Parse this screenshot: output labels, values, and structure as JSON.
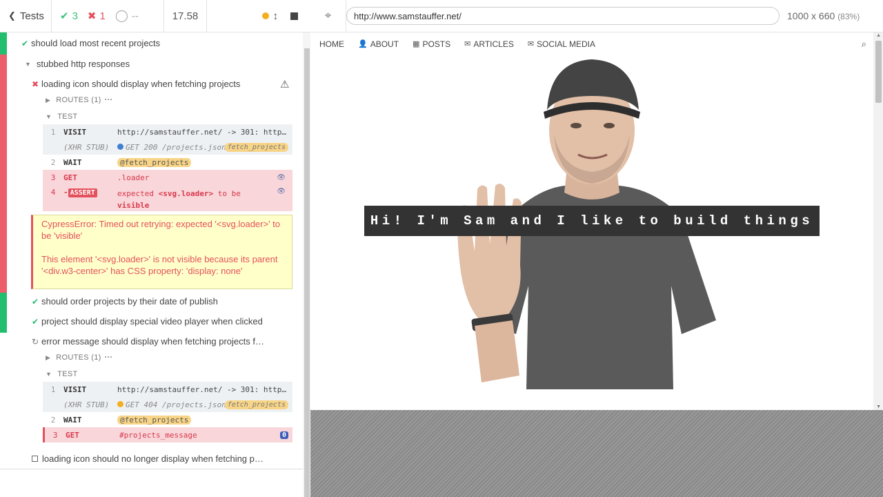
{
  "stats": {
    "tests_label": "Tests",
    "passed": "3",
    "failed": "1",
    "pending": "--",
    "duration": "17.58"
  },
  "tests": {
    "t1": "should load most recent projects",
    "suite": "stubbed http responses",
    "t2": "loading icon should display when fetching projects",
    "routes_1": "ROUTES (1)",
    "test_label": "TEST",
    "t2_cmds": [
      {
        "num": "1",
        "name": "VISIT",
        "msg": "http://samstauffer.net/ -> 301: http…"
      },
      {
        "num": "",
        "name": "(XHR STUB)",
        "msg": "GET 200 /projects.json",
        "tag": "fetch_projects"
      },
      {
        "num": "2",
        "name": "WAIT",
        "msg": "@fetch_projects"
      },
      {
        "num": "3",
        "name": "GET",
        "msg": ".loader"
      },
      {
        "num": "4",
        "name": "ASSERT",
        "msg1": "expected ",
        "msg2": "<svg.loader>",
        "msg3": " to be",
        "msg4": "visible"
      }
    ],
    "error_p1": "CypressError: Timed out retrying: expected '<svg.loader>' to be 'visible'",
    "error_p2": "This element '<svg.loader>' is not visible because its parent '<div.w3-center>' has CSS property: 'display: none'",
    "t3": "should order projects by their date of publish",
    "t4": "project should display special video player when clicked",
    "t5": "error message should display when fetching projects f…",
    "routes_2": "ROUTES (1)",
    "test_label_2": "TEST",
    "t5_cmds": [
      {
        "num": "1",
        "name": "VISIT",
        "msg": "http://samstauffer.net/ -> 301: http…"
      },
      {
        "num": "",
        "name": "(XHR STUB)",
        "msg": "GET 404 /projects.json",
        "tag": "fetch_projects"
      },
      {
        "num": "2",
        "name": "WAIT",
        "msg": "@fetch_projects"
      },
      {
        "num": "3",
        "name": "GET",
        "msg": "#projects_message",
        "count": "0"
      }
    ],
    "t6": "loading icon should no longer display when fetching p…"
  },
  "aut": {
    "url": "http://www.samstauffer.net/",
    "viewport": "1000 x 660",
    "scale": "(83%)",
    "nav": [
      "HOME",
      "ABOUT",
      "POSTS",
      "ARTICLES",
      "SOCIAL MEDIA"
    ],
    "hero_title": "Hi! I'm Sam and I like to build things"
  },
  "colors": {
    "pass": "#22be6e",
    "fail": "#e4505c",
    "pending_dot": "#f3ae21",
    "error_bg": "#ffffca"
  }
}
